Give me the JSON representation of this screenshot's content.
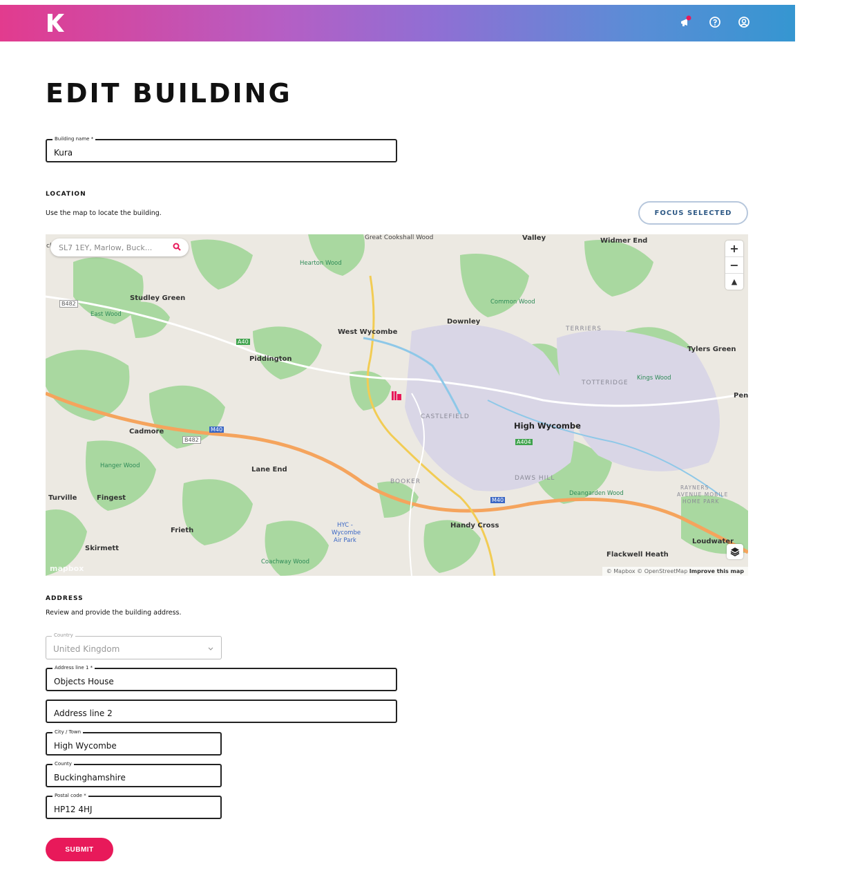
{
  "header": {
    "brand_color_start": "#e23b8e",
    "brand_color_end": "#3596d1",
    "icons": [
      "announcement-icon",
      "help-icon",
      "account-icon"
    ]
  },
  "page": {
    "title": "EDIT BUILDING"
  },
  "building_name": {
    "label": "Building name *",
    "value": "Kura"
  },
  "location": {
    "heading": "LOCATION",
    "description": "Use the map to locate the building.",
    "focus_button": "FOCUS SELECTED"
  },
  "map": {
    "search_value": "SL7 1EY, Marlow, Buck...",
    "search_prefix": "ch",
    "zoom_in": "+",
    "zoom_out": "−",
    "compass": "▲",
    "logo": "mapbox",
    "attribution_1": "© Mapbox © OpenStreetMap",
    "attribution_2": "Improve this map",
    "labels": {
      "bc_wood": "Great Cookshall Wood",
      "valley": "Valley",
      "widmer": "Widmer End",
      "hearton": "Hearton Wood",
      "studley": "Studley Green",
      "east_wood": "East Wood",
      "common_wood": "Common Wood",
      "downley": "Downley",
      "west_wycombe": "West Wycombe",
      "terriers": "TERRIERS",
      "piddington": "Piddington",
      "tylers": "Tylers Green",
      "totteridge": "TOTTERIDGE",
      "kings_wood": "Kings Wood",
      "castlefield": "CASTLEFIELD",
      "high_wycombe": "High Wycombe",
      "cadmore": "Cadmore",
      "hanger_wood": "Hanger Wood",
      "lane_end": "Lane End",
      "booker": "BOOKER",
      "daws_hill": "DAWS HILL",
      "deangarden": "Deangarden Wood",
      "rayners": "RAYNERS",
      "avenue": "AVENUE MOBILE",
      "home_park": "HOME PARK",
      "turville": "Turville",
      "fingest": "Fingest",
      "hyc": "HYC -",
      "wycombe": "Wycombe",
      "air_park": "Air Park",
      "handy_cross": "Handy Cross",
      "frieth": "Frieth",
      "skirmett": "Skirmett",
      "flackwell": "Flackwell Heath",
      "loudwater": "Loudwater",
      "coachway": "Coachway Wood",
      "penn": "Penn",
      "b482": "B482",
      "b482b": "B482",
      "a40": "A40",
      "m40": "M40",
      "m40b": "M40",
      "a404": "A404"
    }
  },
  "address": {
    "heading": "ADDRESS",
    "description": "Review and provide the building address.",
    "country": {
      "label": "Country",
      "value": "United Kingdom"
    },
    "line1": {
      "label": "Address line 1 *",
      "value": "Objects House"
    },
    "line2": {
      "placeholder": "Address line 2"
    },
    "city": {
      "label": "City / Town",
      "value": "High Wycombe"
    },
    "county": {
      "label": "County",
      "value": "Buckinghamshire"
    },
    "postal": {
      "label": "Postal code *",
      "value": "HP12 4HJ"
    }
  },
  "submit_label": "SUBMIT",
  "submit_color": "#e8195a"
}
